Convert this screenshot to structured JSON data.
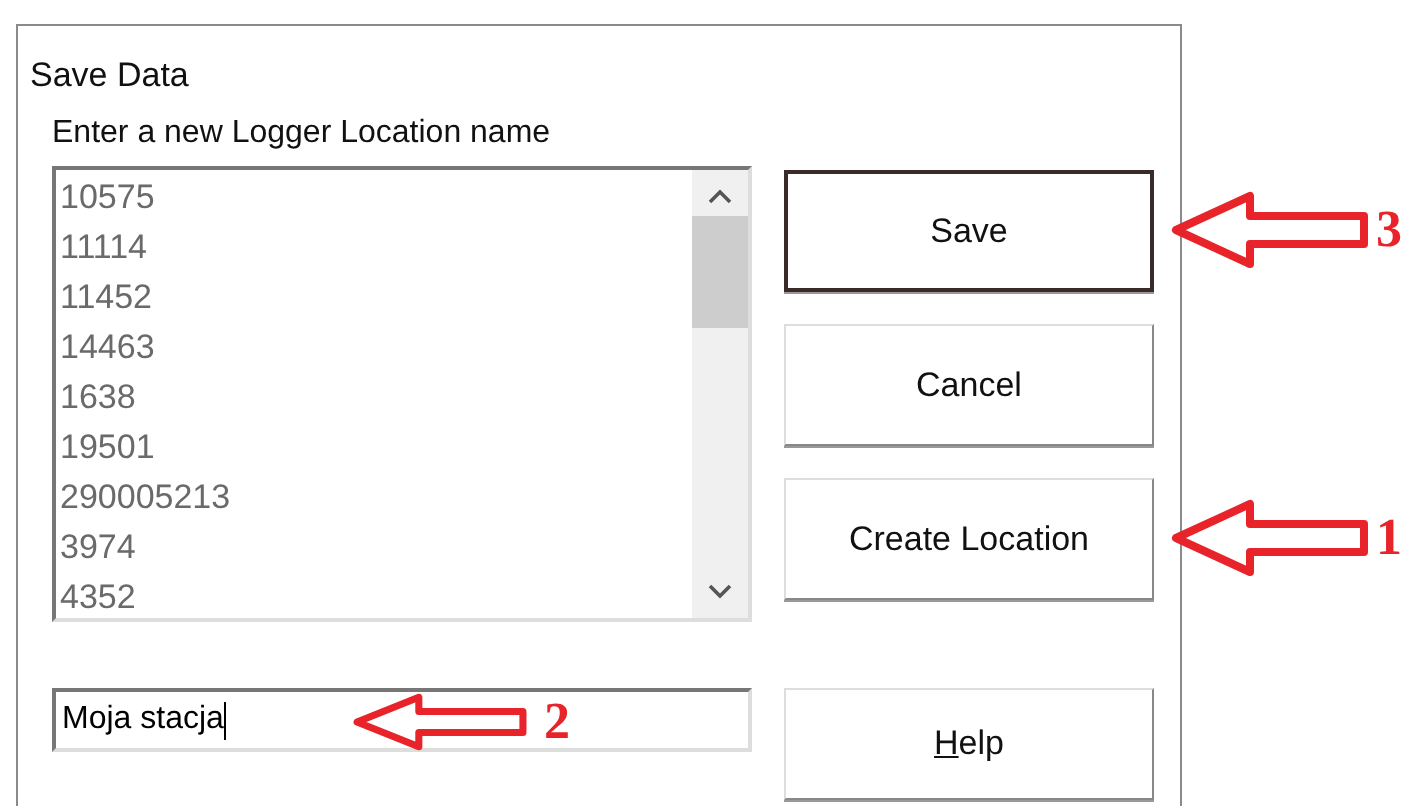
{
  "dialog": {
    "title": "Save Data",
    "prompt": "Enter a new Logger Location name",
    "locations": [
      "10575",
      "11114",
      "11452",
      "14463",
      "1638",
      "19501",
      "290005213",
      "3974",
      "4352"
    ],
    "name_field": {
      "value": "Moja stacja",
      "callout": "2"
    },
    "buttons": [
      {
        "label": "Save",
        "default": true,
        "mnemonic": false,
        "callout": "3"
      },
      {
        "label": "Cancel",
        "default": false,
        "mnemonic": false
      },
      {
        "label": "Create Location",
        "default": false,
        "mnemonic": false,
        "callout": "1"
      },
      {
        "label": "Help",
        "default": false,
        "mnemonic": true
      }
    ]
  }
}
